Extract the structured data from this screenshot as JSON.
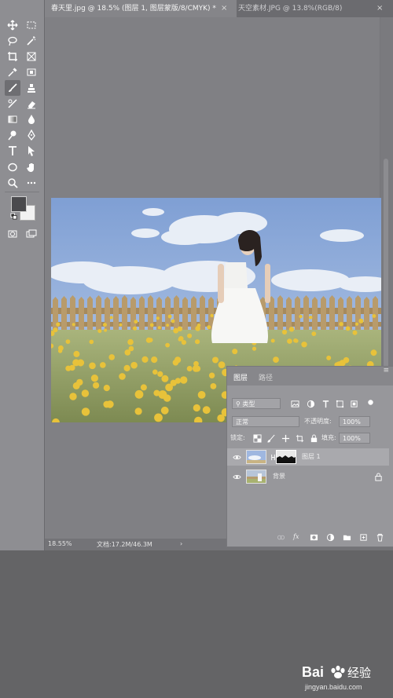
{
  "tabs": [
    {
      "label": "春天里.jpg @ 18.5% (图层 1, 图层蒙版/8/CMYK) *",
      "close": "×"
    },
    {
      "label": "天空素材.JPG @ 13.8%(RGB/8)",
      "close": "×"
    }
  ],
  "status": {
    "zoom": "18.55%",
    "doc": "文档:17.2M/46.3M",
    "arrow": "›"
  },
  "layers_panel": {
    "tabs": [
      "图层",
      "路径"
    ],
    "filter_kind": "类型",
    "blend_mode": "正常",
    "opacity_label": "不透明度:",
    "opacity_value": "100%",
    "lock_label": "锁定:",
    "fill_label": "填充:",
    "fill_value": "100%",
    "layers": [
      {
        "name": "图层 1",
        "selected": true,
        "has_mask": true
      },
      {
        "name": "背景",
        "selected": false,
        "locked": true
      }
    ],
    "bottom_icons": [
      "link-icon",
      "fx-icon",
      "mask-icon",
      "adjustment-icon",
      "folder-icon",
      "new-layer-icon",
      "trash-icon"
    ],
    "fx_label": "fx"
  },
  "watermark": {
    "brand": "Bai",
    "brand2": "经验",
    "url": "jingyan.baidu.com"
  }
}
